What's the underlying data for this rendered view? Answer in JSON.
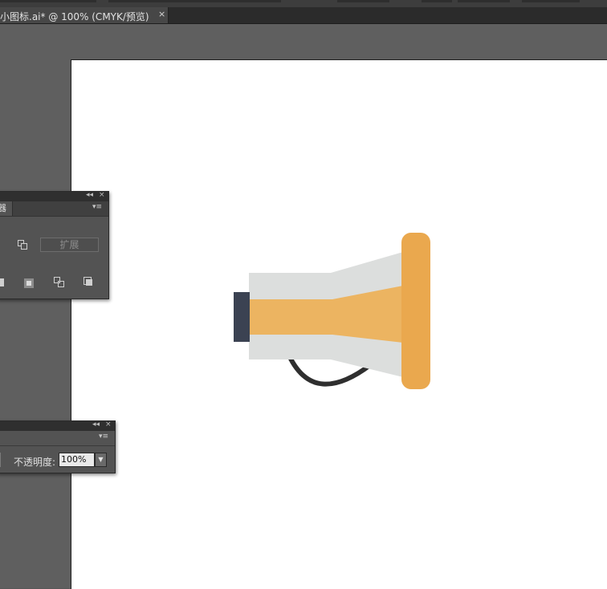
{
  "document_tab": {
    "title": "小图标.ai* @ 100% (CMYK/预览)",
    "close_glyph": "×"
  },
  "pathfinder_panel": {
    "tab_label": "器",
    "collapse_glyph": "◂◂",
    "close_glyph": "×",
    "menu_glyph": "▾≡",
    "expand_button": "扩展"
  },
  "transparency_panel": {
    "collapse_glyph": "◂◂",
    "close_glyph": "×",
    "menu_glyph": "▾≡",
    "opacity_label": "不透明度:",
    "opacity_value": "100%",
    "dropdown_glyph": "▼"
  },
  "artwork": {
    "description_colors": {
      "cone_gray": "#dcdedd",
      "band_orange": "#ecb461",
      "rim_orange": "#eaa84e",
      "handle_dark": "#3b4252",
      "strap_dark": "#2f2f2f"
    }
  }
}
